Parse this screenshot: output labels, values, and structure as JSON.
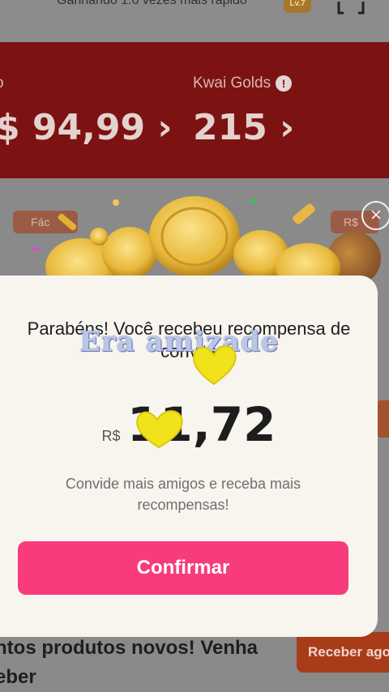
{
  "header": {
    "speed_text": "Ganhando 1.6 vezes mais rápido",
    "level_badge": "Lv.7"
  },
  "balances": {
    "cash_value": "$ 94,99 ›",
    "golds_label": "Kwai Golds",
    "golds_value": "215 ›"
  },
  "side_tags": {
    "left": "Fác",
    "right": "R$"
  },
  "modal": {
    "title": "Parabéns! Você recebeu recompensa de convite",
    "currency": "R$",
    "amount": "11,72",
    "subtitle": "Convide mais amigos e receba mais recompensas!",
    "confirm_label": "Confirmar",
    "close_symbol": "×"
  },
  "overlay": {
    "watermark_text": "Era amizade"
  },
  "background_footer": {
    "text": "ntos produtos novos! Venha eber",
    "button_label": "Receber ago"
  },
  "colors": {
    "accent_pink": "#f73b7d",
    "card_red": "#7d1212",
    "coin_gold": "#e8b93c"
  }
}
